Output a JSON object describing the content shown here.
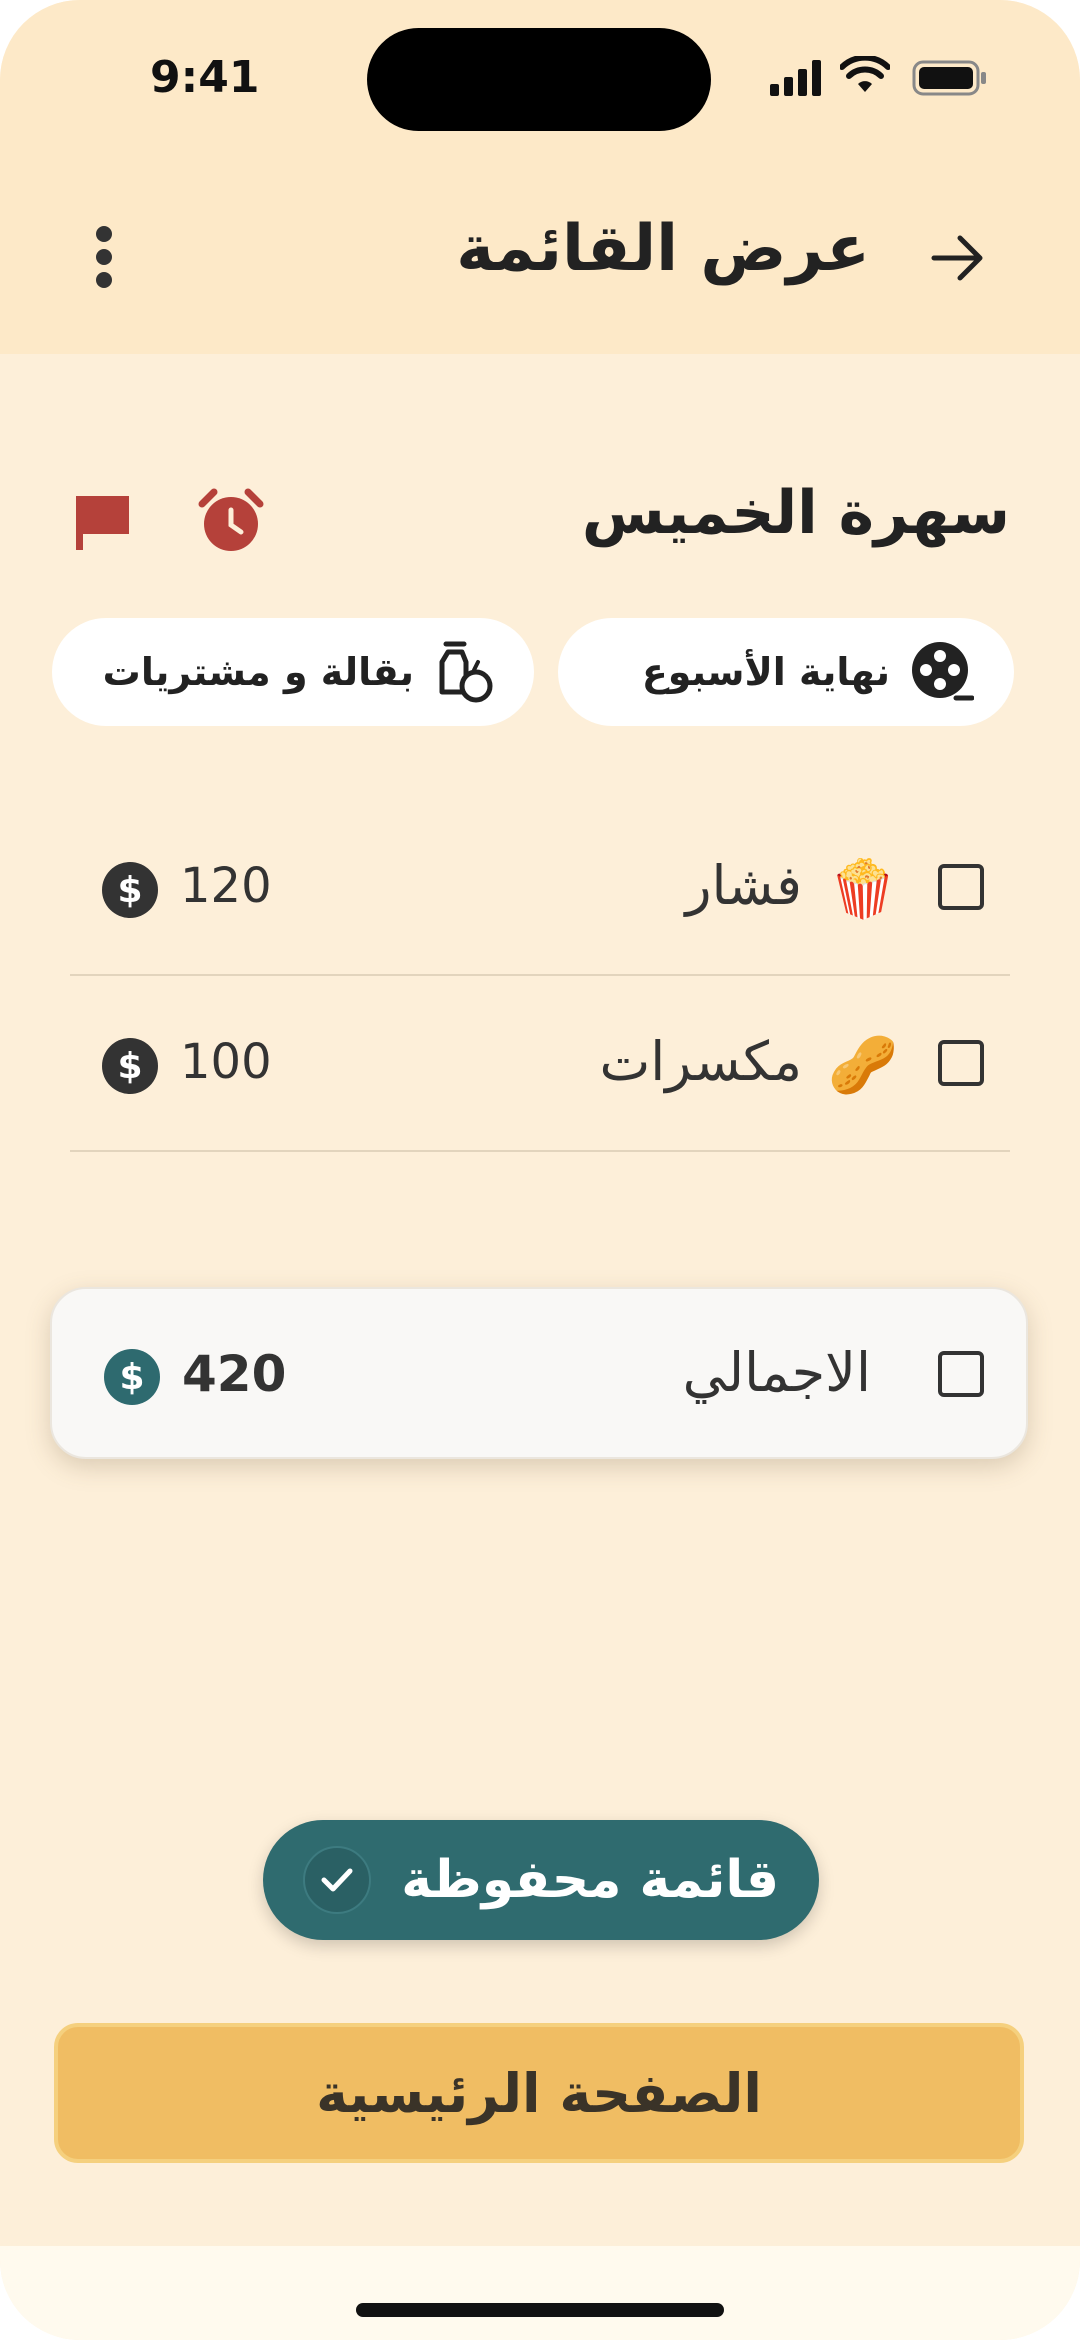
{
  "status_bar": {
    "time": "9:41"
  },
  "header": {
    "title": "عرض القائمة",
    "back_icon": "arrow-right-icon",
    "menu_icon": "more-vertical-icon"
  },
  "list": {
    "title": "سهرة الخميس",
    "chips": [
      {
        "label": "نهاية الأسبوع",
        "icon": "film-reel-icon"
      },
      {
        "label": "بقالة و مشتريات",
        "icon": "groceries-icon"
      }
    ],
    "items": [
      {
        "emoji": "🍿",
        "name": "فشار",
        "price": "120"
      },
      {
        "emoji": "🥜",
        "name": "مكسرات",
        "price": "100"
      }
    ],
    "currency_symbol": "$"
  },
  "total": {
    "label": "الاجمالي",
    "value": "420"
  },
  "toast": {
    "text": "قائمة محفوظة"
  },
  "home_button": {
    "label": "الصفحة الرئيسية"
  },
  "colors": {
    "background": "#fdefd9",
    "accent_teal": "#2f6b6f",
    "button_yellow": "#f0bd63",
    "icon_red": "#b5413a"
  }
}
